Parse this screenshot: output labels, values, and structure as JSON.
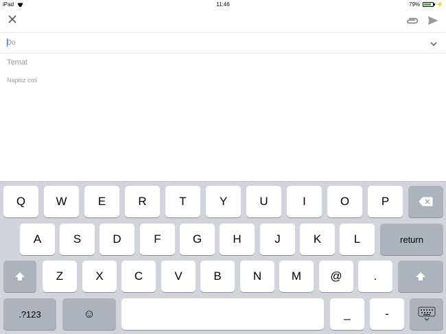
{
  "status_bar": {
    "device": "iPad",
    "time": "11:46",
    "battery_percent": "79%",
    "battery_level": 0.79
  },
  "toolbar": {
    "close_icon": "close-icon",
    "attach_icon": "paperclip-icon",
    "send_icon": "send-icon"
  },
  "to_field": {
    "label": "Do",
    "chevron_icon": "chevron-down-icon"
  },
  "subject_field": {
    "placeholder": "Temat"
  },
  "body_field": {
    "placeholder": "Napisz coś"
  },
  "keyboard": {
    "row1": [
      "Q",
      "W",
      "E",
      "R",
      "T",
      "Y",
      "U",
      "I",
      "O",
      "P"
    ],
    "row2": [
      "A",
      "S",
      "D",
      "F",
      "G",
      "H",
      "J",
      "K",
      "L"
    ],
    "row3": [
      "Z",
      "X",
      "C",
      "V",
      "B",
      "N",
      "M",
      "@",
      "."
    ],
    "return_label": "return",
    "numbers_label": ".?123",
    "underscore_label": "_",
    "dash_label": "-",
    "emoji_glyph": "☺"
  },
  "colors": {
    "keyboard_bg": "#d1d5db",
    "key_bg": "#ffffff",
    "modifier_key_bg": "#acb3bc",
    "battery_fill": "#36c036",
    "caret": "#3478f6"
  }
}
